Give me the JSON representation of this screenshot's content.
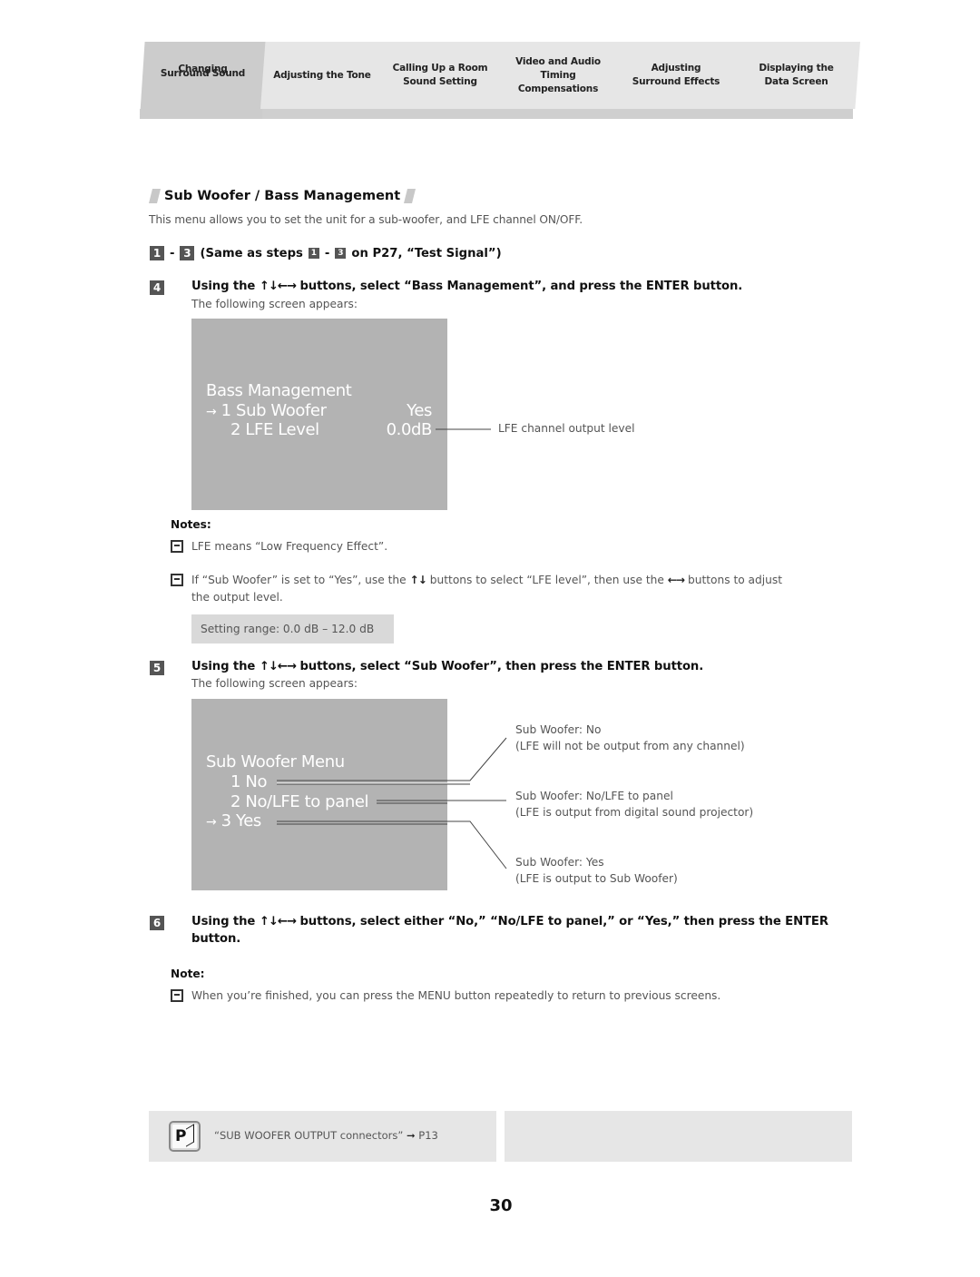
{
  "tabs": [
    {
      "label_lines": [
        "Changing",
        "Surround Sound"
      ],
      "active": true
    },
    {
      "label_lines": [
        "Adjusting the Tone"
      ],
      "active": false
    },
    {
      "label_lines": [
        "Calling Up a Room",
        "Sound Setting"
      ],
      "active": false
    },
    {
      "label_lines": [
        "Video and Audio",
        "Timing",
        "Compensations"
      ],
      "active": false
    },
    {
      "label_lines": [
        "Adjusting",
        "Surround Effects"
      ],
      "active": false
    },
    {
      "label_lines": [
        "Displaying the",
        "Data Screen"
      ],
      "active": false
    }
  ],
  "section": {
    "title": "Sub Woofer / Bass Management",
    "intro": "This menu allows you to set the unit for a sub-woofer, and LFE channel ON/OFF."
  },
  "steps": {
    "range_start": "1",
    "range_end": "3",
    "range_text_a": "(Same as steps",
    "range_text_b": "on P27, “Test Signal”)",
    "dash": "-",
    "arrows_all": "↑↓←→",
    "arrows_ud": "↑↓",
    "arrows_lr": "←→",
    "s4": {
      "num": "4",
      "pre": "Using the",
      "post": "buttons, select “Bass Management”, and press the ENTER button.",
      "sub": "The following screen appears:"
    },
    "s5": {
      "num": "5",
      "pre": "Using the",
      "post": "buttons, select “Sub Woofer”, then press the ENTER button.",
      "sub": "The following screen appears:"
    },
    "s6": {
      "num": "6",
      "pre": "Using the",
      "post": "buttons, select either “No,” “No/LFE to panel,” or “Yes,” then press the ENTER",
      "post2": "button."
    }
  },
  "screen1": {
    "title": "Bass Management",
    "cursor": "→",
    "items": [
      {
        "label": "1  Sub Woofer",
        "value": "Yes",
        "selected": true
      },
      {
        "label": "2  LFE Level",
        "value": "0.0dB",
        "selected": false
      }
    ],
    "callout": "LFE channel output level"
  },
  "notes1": {
    "label": "Notes:",
    "items": [
      "LFE means “Low Frequency Effect”.",
      {
        "a": "If “Sub Woofer” is set to “Yes”, use the",
        "b": "buttons to select “LFE level”, then use the",
        "c": "buttons to adjust",
        "d": "the output level."
      }
    ],
    "range": "Setting range: 0.0 dB – 12.0 dB"
  },
  "screen2": {
    "title": "Sub Woofer Menu",
    "cursor": "→",
    "items": [
      {
        "label": "1  No",
        "selected": false
      },
      {
        "label": "2  No/LFE to panel",
        "selected": false
      },
      {
        "label": "3  Yes",
        "selected": true
      }
    ],
    "callouts": [
      {
        "line1": "Sub Woofer: No",
        "line2": "(LFE will not be output from any channel)"
      },
      {
        "line1": "Sub Woofer: No/LFE to panel",
        "line2": "(LFE is output from digital sound projector)"
      },
      {
        "line1": "Sub Woofer: Yes",
        "line2": "(LFE is output to Sub Woofer)"
      }
    ]
  },
  "notes2": {
    "label": "Note:",
    "text": "When you’re finished, you can press the MENU button repeatedly to return to previous screens."
  },
  "footer": {
    "ref_icon": "P",
    "ref_text": "“SUB WOOFER OUTPUT connectors”",
    "ref_arrow": "➞",
    "ref_page": "P13",
    "page_number": "30"
  }
}
